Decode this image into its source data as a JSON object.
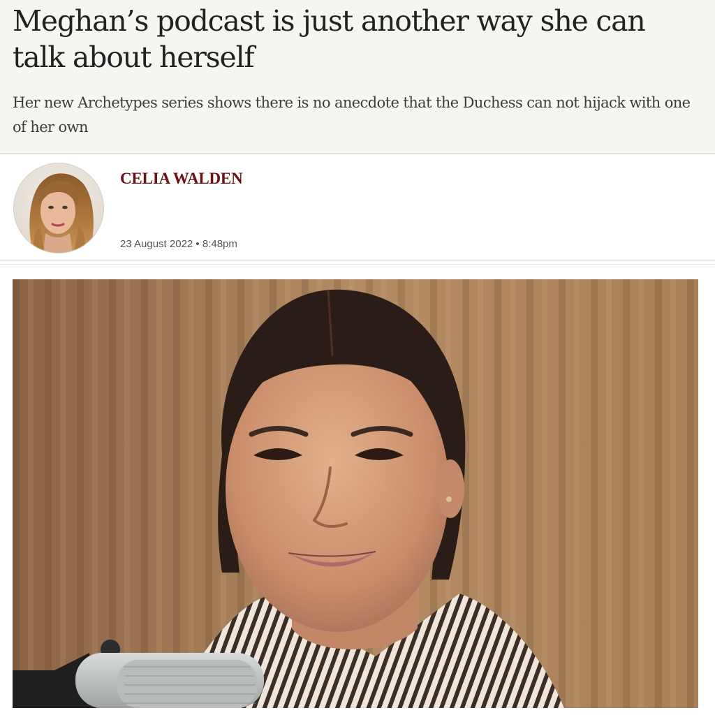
{
  "article": {
    "headline": "Meghan’s podcast is just another way she can talk about herself",
    "standfirst": "Her new Archetypes series shows there is no anecdote that the Duchess can not hijack with one of her own",
    "author": "CELIA WALDEN",
    "published": "23 August 2022 • 8:48pm"
  },
  "colors": {
    "header_background": "#f7f5f1",
    "author_link": "#6b1016",
    "headline_text": "#222222"
  }
}
